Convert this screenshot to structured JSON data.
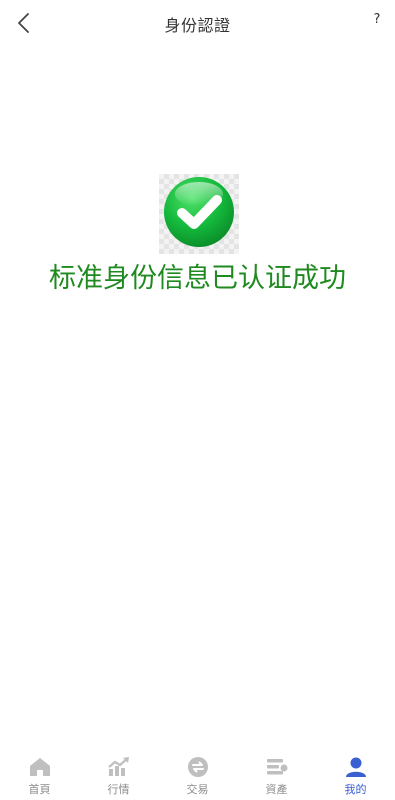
{
  "header": {
    "title": "身份認證",
    "help_label": "?"
  },
  "main": {
    "success_message": "标准身份信息已认证成功"
  },
  "colors": {
    "success_text": "#1f8a1f",
    "tab_active": "#3a5fd1",
    "tab_inactive": "#bfbfbf"
  },
  "tabbar": {
    "items": [
      {
        "label": "首頁",
        "icon": "home-icon",
        "active": false
      },
      {
        "label": "行情",
        "icon": "chart-icon",
        "active": false
      },
      {
        "label": "交易",
        "icon": "exchange-icon",
        "active": false
      },
      {
        "label": "資產",
        "icon": "assets-icon",
        "active": false
      },
      {
        "label": "我的",
        "icon": "user-icon",
        "active": true
      }
    ]
  }
}
